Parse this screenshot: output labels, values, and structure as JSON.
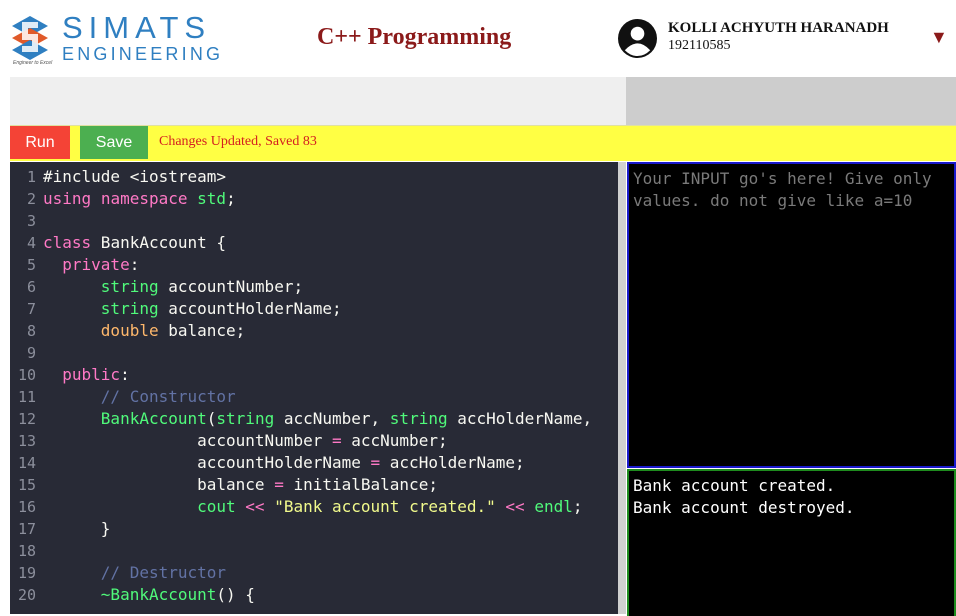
{
  "header": {
    "logo_word": "SIMATS",
    "logo_sub": "ENGINEERING",
    "logo_tagline": "Engineer to Excel",
    "course_title": "C++ Programming",
    "user_name": "KOLLI ACHYUTH HARANADH",
    "user_id": "192110585",
    "user_icon": "user-avatar-icon",
    "caret_icon": "caret-down-icon"
  },
  "toolbar": {
    "run_label": "Run",
    "save_label": "Save",
    "status_text": "Changes Updated, Saved 83"
  },
  "editor": {
    "line_numbers": [
      "1",
      "2",
      "3",
      "4",
      "5",
      "6",
      "7",
      "8",
      "9",
      "10",
      "11",
      "12",
      "13",
      "14",
      "15",
      "16",
      "17",
      "18",
      "19",
      "20"
    ],
    "lines": [
      "#include <iostream>",
      "using namespace std;",
      "",
      "class BankAccount {",
      "  private:",
      "      string accountNumber;",
      "      string accountHolderName;",
      "      double balance;",
      "",
      "  public:",
      "      // Constructor",
      "      BankAccount(string accNumber, string accHolderName,",
      "                accountNumber = accNumber;",
      "                accountHolderName = accHolderName;",
      "                balance = initialBalance;",
      "                cout << \"Bank account created.\" << endl;",
      "      }",
      "",
      "      // Destructor",
      "      ~BankAccount() {"
    ]
  },
  "input_panel": {
    "placeholder": "Your INPUT go's here! Give only values. do not give like a=10",
    "value": ""
  },
  "output_panel": {
    "lines": [
      "Bank account created.",
      "Bank account destroyed."
    ]
  },
  "colors": {
    "run": "#f44336",
    "save": "#4caf50",
    "toolbar": "#ffff44",
    "editor_bg": "#282a36",
    "brand_blue": "#2f7fc1",
    "title_red": "#8b1a1a"
  }
}
